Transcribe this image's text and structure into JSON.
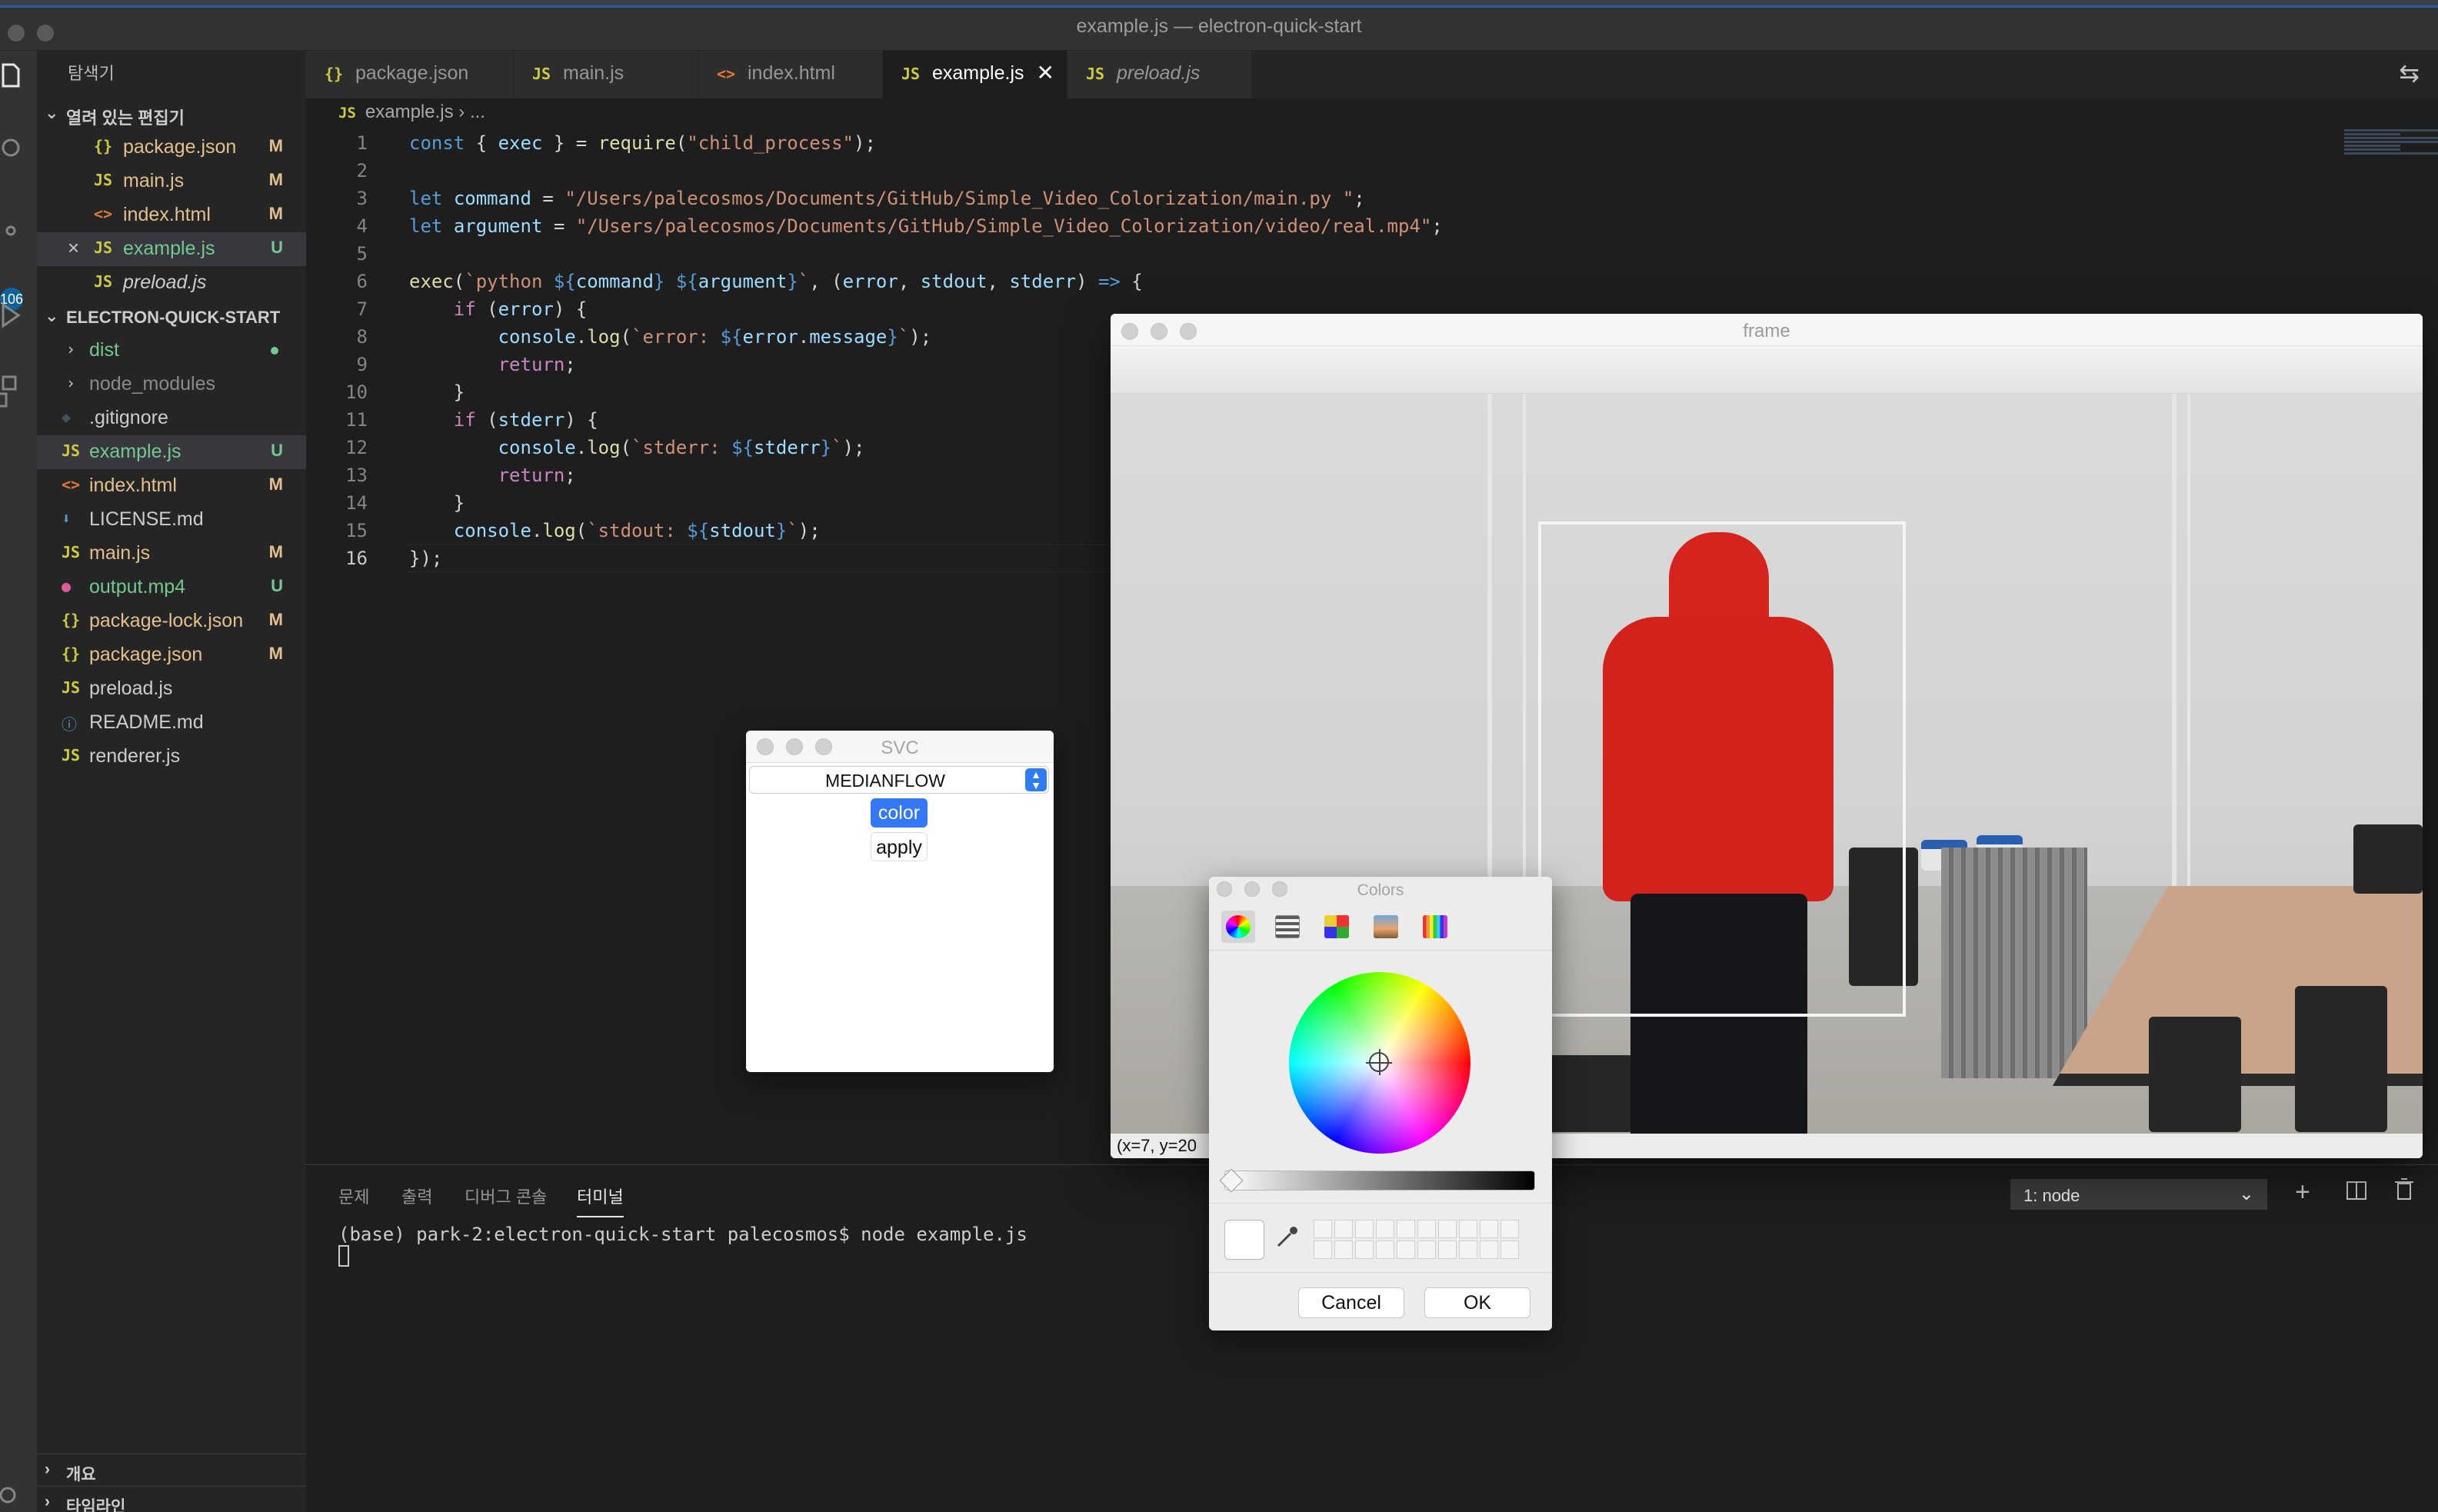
{
  "window": {
    "title": "example.js — electron-quick-start"
  },
  "activity_bar": {
    "badge": "106"
  },
  "sidebar": {
    "title": "탐색기",
    "open_editors_label": "열려 있는 편집기",
    "open_editors": [
      {
        "icon": "{}",
        "name": "package.json",
        "status": "M"
      },
      {
        "icon": "JS",
        "name": "main.js",
        "status": "M"
      },
      {
        "icon": "<>",
        "name": "index.html",
        "status": "M"
      },
      {
        "icon": "JS",
        "name": "example.js",
        "status": "U"
      },
      {
        "icon": "JS",
        "name": "preload.js",
        "status": ""
      }
    ],
    "project_label": "ELECTRON-QUICK-START",
    "project_files": [
      {
        "icon": "›",
        "name": "dist",
        "status": ""
      },
      {
        "icon": "›",
        "name": "node_modules",
        "status": ""
      },
      {
        "icon": "◆",
        "name": ".gitignore",
        "status": ""
      },
      {
        "icon": "JS",
        "name": "example.js",
        "status": "U"
      },
      {
        "icon": "<>",
        "name": "index.html",
        "status": "M"
      },
      {
        "icon": "⬇",
        "name": "LICENSE.md",
        "status": ""
      },
      {
        "icon": "JS",
        "name": "main.js",
        "status": "M"
      },
      {
        "icon": "●",
        "name": "output.mp4",
        "status": "U"
      },
      {
        "icon": "{}",
        "name": "package-lock.json",
        "status": "M"
      },
      {
        "icon": "{}",
        "name": "package.json",
        "status": "M"
      },
      {
        "icon": "JS",
        "name": "preload.js",
        "status": ""
      },
      {
        "icon": "ⓘ",
        "name": "README.md",
        "status": ""
      },
      {
        "icon": "JS",
        "name": "renderer.js",
        "status": ""
      }
    ],
    "outline_label": "개요",
    "timeline_label": "타임라인"
  },
  "tabs": [
    {
      "icon": "{}",
      "label": "package.json"
    },
    {
      "icon": "JS",
      "label": "main.js"
    },
    {
      "icon": "<>",
      "label": "index.html"
    },
    {
      "icon": "JS",
      "label": "example.js",
      "close": "✕"
    },
    {
      "icon": "JS",
      "label": "preload.js"
    }
  ],
  "breadcrumb": {
    "icon": "JS",
    "file": "example.js",
    "rest": "› ..."
  },
  "code": {
    "line_numbers": [
      "1",
      "2",
      "3",
      "4",
      "5",
      "6",
      "7",
      "8",
      "9",
      "10",
      "11",
      "12",
      "13",
      "14",
      "15",
      "16"
    ]
  },
  "panel": {
    "tabs": [
      "문제",
      "출력",
      "디버그 콘솔",
      "터미널"
    ],
    "terminal_select": "1: node",
    "terminal_line": "(base) park-2:electron-quick-start palecosmos$ node example.js"
  },
  "frame_window": {
    "title": "frame",
    "status": "(x=7, y=20"
  },
  "svc_window": {
    "title": "SVC",
    "tracker_value": "MEDIANFLOW",
    "color_button": "color",
    "apply_button": "apply"
  },
  "colors_window": {
    "title": "Colors",
    "cancel_button": "Cancel",
    "ok_button": "OK"
  }
}
